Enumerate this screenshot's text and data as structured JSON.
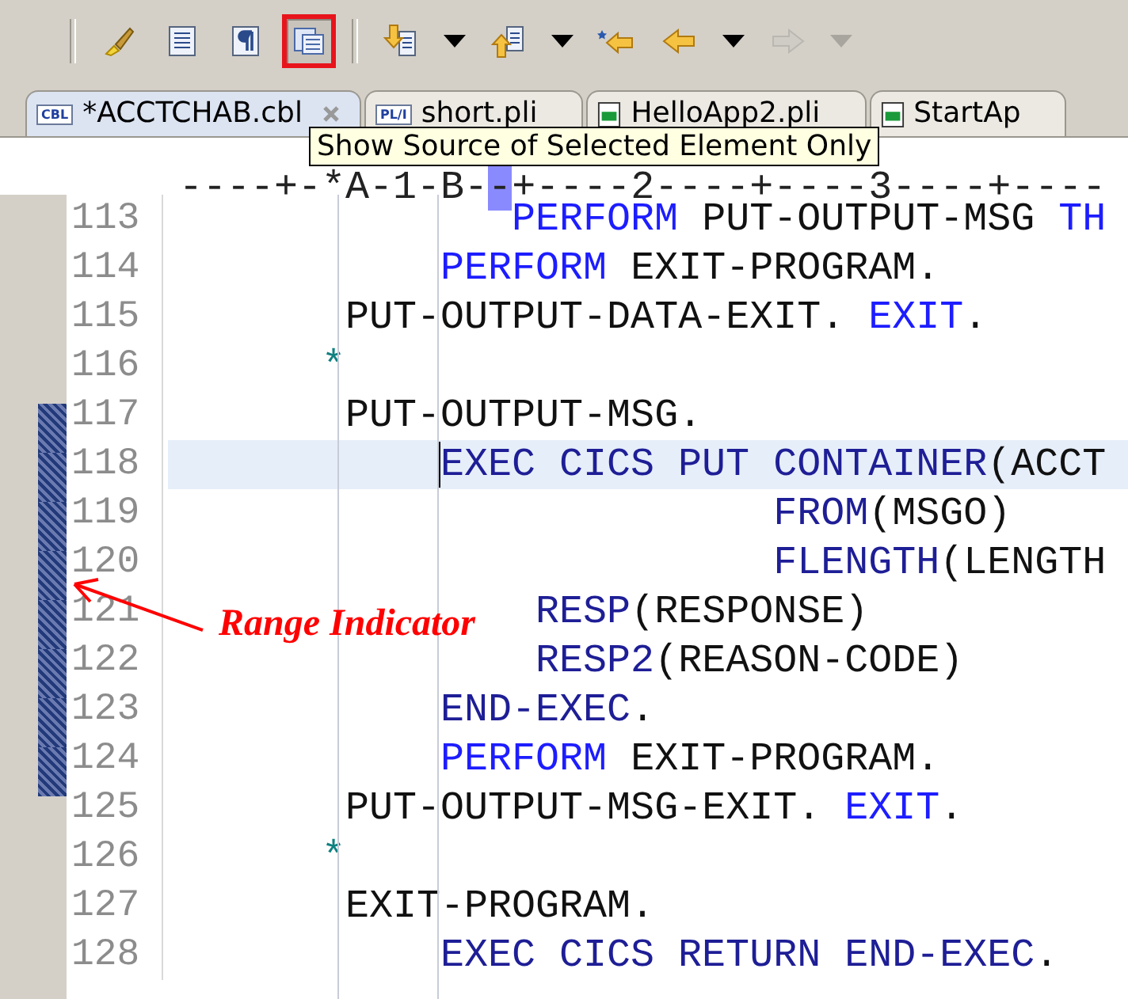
{
  "toolbar": {
    "items": [
      {
        "kind": "separator"
      },
      {
        "kind": "button",
        "highlighted": false,
        "disabled": false
      },
      {
        "kind": "button",
        "highlighted": false,
        "disabled": false
      },
      {
        "kind": "button",
        "highlighted": false,
        "disabled": false
      },
      {
        "kind": "button",
        "highlighted": true,
        "disabled": false
      },
      {
        "kind": "separator"
      },
      {
        "kind": "button",
        "highlighted": false,
        "disabled": false
      },
      {
        "kind": "dropdown",
        "disabled": false
      },
      {
        "kind": "button",
        "highlighted": false,
        "disabled": false
      },
      {
        "kind": "dropdown",
        "disabled": false
      },
      {
        "kind": "button",
        "highlighted": false,
        "disabled": false
      },
      {
        "kind": "button",
        "highlighted": false,
        "disabled": false
      },
      {
        "kind": "dropdown",
        "disabled": false
      },
      {
        "kind": "button",
        "highlighted": false,
        "disabled": true
      },
      {
        "kind": "dropdown",
        "disabled": true
      }
    ]
  },
  "tabs": [
    {
      "label": "*ACCTCHAB.cbl",
      "badge": "CBL",
      "selected": true,
      "closable": true
    },
    {
      "label": "short.pli",
      "badge": "PL/I",
      "selected": false,
      "closable": false
    },
    {
      "label": "HelloApp2.pli",
      "selected": false,
      "closable": false
    },
    {
      "label": "StartAp",
      "selected": false,
      "closable": false
    }
  ],
  "tooltip": {
    "text": "Show Source of Selected Element Only"
  },
  "ruler": {
    "segments": [
      {
        "text": "----+-*A-1-B-",
        "marked": false
      },
      {
        "text": "-",
        "marked": true
      },
      {
        "text": "+----2----+----3----+----",
        "marked": false
      }
    ]
  },
  "editor": {
    "lines": [
      {
        "number": "113",
        "highlighted": false,
        "in_range": false,
        "tokens": [
          {
            "text": "              PERFORM",
            "kind": "keyword"
          },
          {
            "text": " PUT-OUTPUT-MSG ",
            "kind": "plain"
          },
          {
            "text": "TH",
            "kind": "keyword"
          }
        ]
      },
      {
        "number": "114",
        "highlighted": false,
        "in_range": false,
        "tokens": [
          {
            "text": "           PERFORM",
            "kind": "keyword"
          },
          {
            "text": " EXIT-PROGRAM.",
            "kind": "plain"
          }
        ]
      },
      {
        "number": "115",
        "highlighted": false,
        "in_range": false,
        "tokens": [
          {
            "text": "       PUT-OUTPUT-DATA-EXIT. ",
            "kind": "plain"
          },
          {
            "text": "EXIT",
            "kind": "keyword"
          },
          {
            "text": ".",
            "kind": "plain"
          }
        ]
      },
      {
        "number": "116",
        "highlighted": false,
        "in_range": false,
        "tokens": [
          {
            "text": "      *",
            "kind": "comment"
          }
        ]
      },
      {
        "number": "117",
        "highlighted": false,
        "in_range": true,
        "tokens": [
          {
            "text": "       PUT-OUTPUT-MSG.",
            "kind": "plain"
          }
        ]
      },
      {
        "number": "118",
        "highlighted": true,
        "in_range": true,
        "tokens": [
          {
            "text": "           EXEC CICS PUT CONTAINER",
            "kind": "cics",
            "caret": true
          },
          {
            "text": "(ACCT",
            "kind": "plain"
          }
        ]
      },
      {
        "number": "119",
        "highlighted": false,
        "in_range": true,
        "tokens": [
          {
            "text": "                         FROM",
            "kind": "cics"
          },
          {
            "text": "(MSGO)",
            "kind": "plain"
          }
        ]
      },
      {
        "number": "120",
        "highlighted": false,
        "in_range": true,
        "tokens": [
          {
            "text": "                         FLENGTH",
            "kind": "cics"
          },
          {
            "text": "(LENGTH",
            "kind": "plain"
          }
        ]
      },
      {
        "number": "121",
        "highlighted": false,
        "in_range": true,
        "tokens": [
          {
            "text": "               RESP",
            "kind": "cics"
          },
          {
            "text": "(RESPONSE)",
            "kind": "plain"
          }
        ]
      },
      {
        "number": "122",
        "highlighted": false,
        "in_range": true,
        "tokens": [
          {
            "text": "               RESP2",
            "kind": "cics"
          },
          {
            "text": "(REASON-CODE)",
            "kind": "plain"
          }
        ]
      },
      {
        "number": "123",
        "highlighted": false,
        "in_range": true,
        "tokens": [
          {
            "text": "           END-EXEC",
            "kind": "cics"
          },
          {
            "text": ".",
            "kind": "plain"
          }
        ]
      },
      {
        "number": "124",
        "highlighted": false,
        "in_range": true,
        "tokens": [
          {
            "text": "           PERFORM",
            "kind": "keyword"
          },
          {
            "text": " EXIT-PROGRAM.",
            "kind": "plain"
          }
        ]
      },
      {
        "number": "125",
        "highlighted": false,
        "in_range": false,
        "tokens": [
          {
            "text": "       PUT-OUTPUT-MSG-EXIT. ",
            "kind": "plain"
          },
          {
            "text": "EXIT",
            "kind": "keyword"
          },
          {
            "text": ".",
            "kind": "plain"
          }
        ]
      },
      {
        "number": "126",
        "highlighted": false,
        "in_range": false,
        "tokens": [
          {
            "text": "      *",
            "kind": "comment"
          }
        ]
      },
      {
        "number": "127",
        "highlighted": false,
        "in_range": false,
        "tokens": [
          {
            "text": "       EXIT-PROGRAM.",
            "kind": "plain"
          }
        ]
      },
      {
        "number": "128",
        "highlighted": false,
        "in_range": false,
        "tokens": [
          {
            "text": "           EXEC CICS RETURN END-EXEC",
            "kind": "cics"
          },
          {
            "text": ".",
            "kind": "plain"
          }
        ]
      }
    ]
  },
  "annotation": {
    "label": "Range Indicator"
  }
}
